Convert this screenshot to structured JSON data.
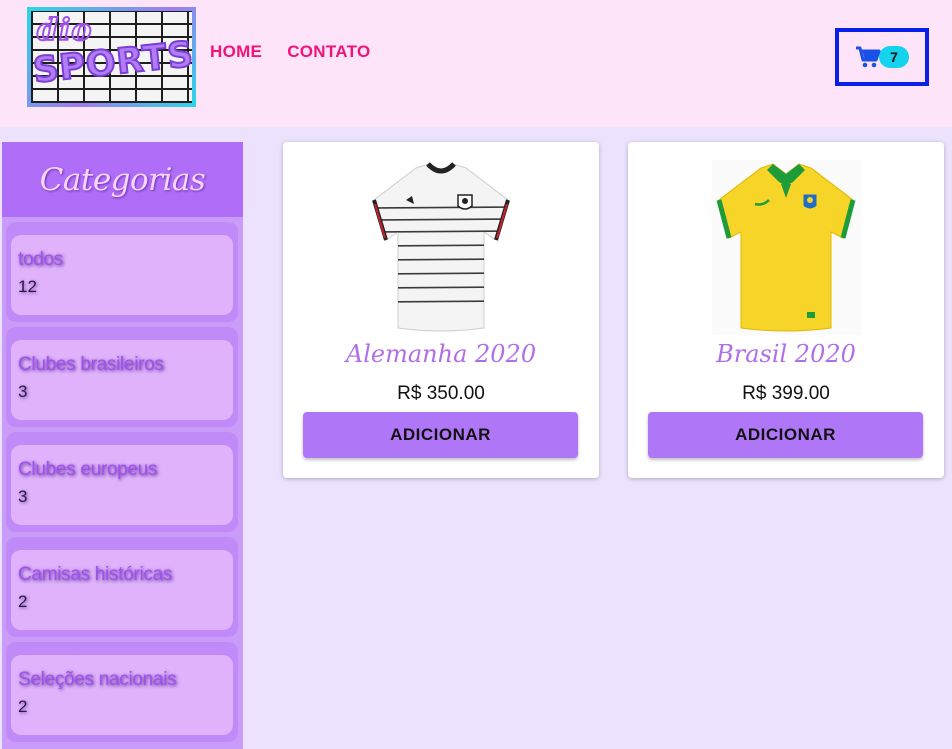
{
  "header": {
    "logo": {
      "top_text": "dio",
      "bottom_text": "SPORTS"
    },
    "nav": [
      {
        "label": "HOME"
      },
      {
        "label": "CONTATO"
      }
    ],
    "cart": {
      "icon": "cart-icon",
      "count": "7"
    }
  },
  "sidebar": {
    "title": "Categorias",
    "items": [
      {
        "name": "todos",
        "count": "12"
      },
      {
        "name": "Clubes brasileiros",
        "count": "3"
      },
      {
        "name": "Clubes europeus",
        "count": "3"
      },
      {
        "name": "Camisas históricas",
        "count": "2"
      },
      {
        "name": "Seleções nacionais",
        "count": "2"
      }
    ]
  },
  "products": [
    {
      "name": "Alemanha 2020",
      "price": "R$ 350.00",
      "button": "ADICIONAR"
    },
    {
      "name": "Brasil 2020",
      "price": "R$ 399.00",
      "button": "ADICIONAR"
    }
  ],
  "colors": {
    "header_bg": "#fde4f8",
    "page_bg": "#ece2fd",
    "nav_link": "#f0147a",
    "cart_border": "#0a1fe8",
    "badge": "#13d4ec",
    "sidebar_bg": "#c99cf9",
    "sidebar_title_bg": "#b06ef8",
    "button": "#b076f8",
    "product_name": "#b06ee8"
  }
}
